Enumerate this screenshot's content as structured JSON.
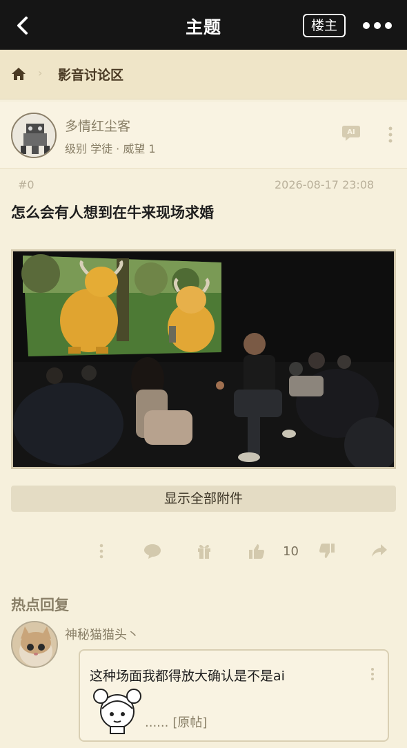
{
  "header": {
    "title": "主题",
    "owner_label": "楼主"
  },
  "breadcrumb": {
    "section": "影音讨论区"
  },
  "post": {
    "author": "多情红尘客",
    "level": "级别 学徒 · 威望 1",
    "floor": "#0",
    "date": "2026-08-17 23:08",
    "title": "怎么会有人想到在牛来现场求婚",
    "attachments_label": "显示全部附件",
    "like_count": "10"
  },
  "hot_replies": {
    "title": "热点回复",
    "items": [
      {
        "user": "神秘猫猫头丶",
        "text": "这种场面我都得放大确认是不是ai",
        "ellipsis": "......",
        "orig_link": "[原帖]"
      }
    ]
  },
  "icons": {
    "back": "chevron-left-icon",
    "more": "more-dots-icon",
    "home": "home-icon",
    "ai": "ai-bubble-icon",
    "comment": "comment-icon",
    "gift": "gift-icon",
    "like": "thumbs-up-icon",
    "dislike": "thumbs-down-icon",
    "share": "share-icon"
  },
  "colors": {
    "topbar": "#151515",
    "background": "#f6f0dc",
    "breadcrumb": "#efe5c8",
    "accent_text": "#8a8068"
  }
}
